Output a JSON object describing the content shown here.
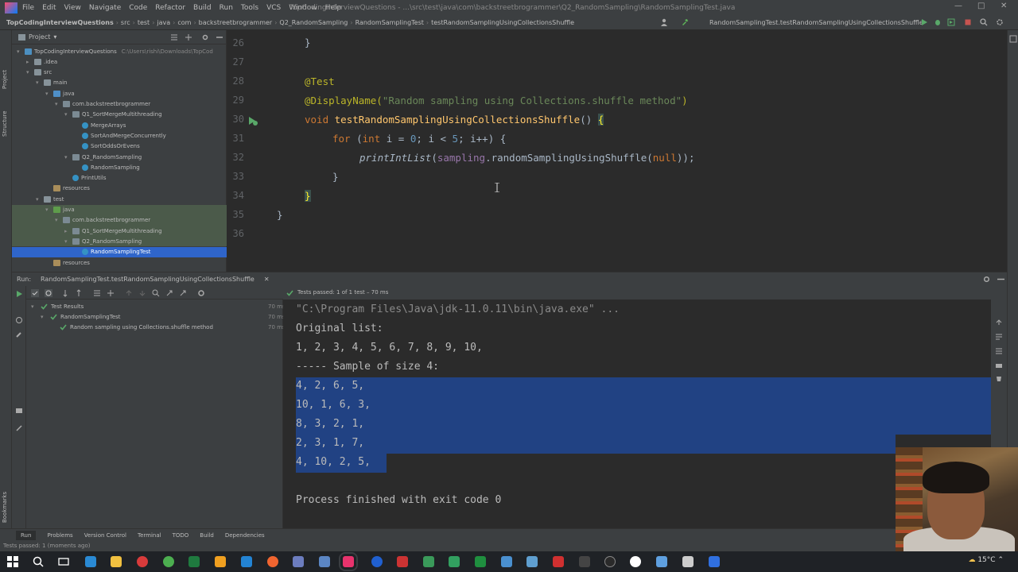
{
  "menubar": {
    "items": [
      "File",
      "Edit",
      "View",
      "Navigate",
      "Code",
      "Refactor",
      "Build",
      "Run",
      "Tools",
      "VCS",
      "Window",
      "Help"
    ],
    "title": "TopCodingInterviewQuestions - ...\\src\\test\\java\\com\\backstreetbrogrammer\\Q2_RandomSampling\\RandomSamplingTest.java"
  },
  "navbar": {
    "crumbs": [
      "TopCodingInterviewQuestions",
      "src",
      "test",
      "java",
      "com",
      "backstreetbrogrammer",
      "Q2_RandomSampling",
      "RandomSamplingTest",
      "testRandomSamplingUsingCollectionsShuffle"
    ],
    "run_config": "RandomSamplingTest.testRandomSamplingUsingCollectionsShuffle"
  },
  "left_stripe": {
    "project_label": "Project",
    "structure_label": "Structure",
    "bookmarks_label": "Bookmarks"
  },
  "project_panel": {
    "header": "Project",
    "tree": [
      {
        "label": "TopCodingInterviewQuestions",
        "extra": "C:\\Users\\rishi\\Downloads\\TopCod",
        "indent": 0,
        "arrow": "▾",
        "icon": "mod"
      },
      {
        "label": ".idea",
        "indent": 1,
        "arrow": "▸",
        "icon": "folder"
      },
      {
        "label": "src",
        "indent": 1,
        "arrow": "▾",
        "icon": "folder"
      },
      {
        "label": "main",
        "indent": 2,
        "arrow": "▾",
        "icon": "folder"
      },
      {
        "label": "java",
        "indent": 3,
        "arrow": "▾",
        "icon": "src"
      },
      {
        "label": "com.backstreetbrogrammer",
        "indent": 4,
        "arrow": "▾",
        "icon": "pkg"
      },
      {
        "label": "Q1_SortMergeMultithreading",
        "indent": 5,
        "arrow": "▾",
        "icon": "pkg"
      },
      {
        "label": "MergeArrays",
        "indent": 6,
        "arrow": "",
        "icon": "cls"
      },
      {
        "label": "SortAndMergeConcurrently",
        "indent": 6,
        "arrow": "",
        "icon": "cls"
      },
      {
        "label": "SortOddsOrEvens",
        "indent": 6,
        "arrow": "",
        "icon": "cls"
      },
      {
        "label": "Q2_RandomSampling",
        "indent": 5,
        "arrow": "▾",
        "icon": "pkg"
      },
      {
        "label": "RandomSampling",
        "indent": 6,
        "arrow": "",
        "icon": "cls"
      },
      {
        "label": "PrintUtils",
        "indent": 5,
        "arrow": "",
        "icon": "cls"
      },
      {
        "label": "resources",
        "indent": 3,
        "arrow": "",
        "icon": "res"
      },
      {
        "label": "test",
        "indent": 2,
        "arrow": "▾",
        "icon": "folder"
      },
      {
        "label": "java",
        "indent": 3,
        "arrow": "▾",
        "icon": "test"
      },
      {
        "label": "com.backstreetbrogrammer",
        "indent": 4,
        "arrow": "▾",
        "icon": "pkg"
      },
      {
        "label": "Q1_SortMergeMultithreading",
        "indent": 5,
        "arrow": "▸",
        "icon": "pkg"
      },
      {
        "label": "Q2_RandomSampling",
        "indent": 5,
        "arrow": "▾",
        "icon": "pkg"
      },
      {
        "label": "RandomSamplingTest",
        "indent": 6,
        "arrow": "",
        "icon": "cls"
      },
      {
        "label": "resources",
        "indent": 3,
        "arrow": "",
        "icon": "res"
      }
    ]
  },
  "editor": {
    "line_numbers": [
      "26",
      "27",
      "28",
      "29",
      "30",
      "31",
      "32",
      "33",
      "34",
      "35",
      "36"
    ],
    "code": {
      "l26": "}",
      "l28": "@Test",
      "l29_ann": "@DisplayName(",
      "l29_str": "\"Random sampling using Collections.shuffle method\"",
      "l29_end": ")",
      "l30_kw": "void ",
      "l30_fn": "testRandomSamplingUsingCollectionsShuffle",
      "l30_rest": "() ",
      "l30_brace": "{",
      "l31_kw1": "for ",
      "l31_a": "(",
      "l31_kw2": "int ",
      "l31_b": "i = ",
      "l31_n0": "0",
      "l31_c": "; i < ",
      "l31_n5": "5",
      "l31_d": "; i++) {",
      "l32_fn": "printIntList",
      "l32_a": "(",
      "l32_fld": "sampling",
      "l32_b": ".randomSamplingUsingShuffle(",
      "l32_null": "null",
      "l32_c": "));",
      "l33": "}",
      "l34": "}",
      "l35": "}"
    }
  },
  "run_panel": {
    "run_label": "Run:",
    "tab_label": "RandomSamplingTest.testRandomSamplingUsingCollectionsShuffle",
    "tests_passed": "Tests passed: 1 of 1 test – 70 ms",
    "tree": [
      {
        "label": "Test Results",
        "time": "70 ms"
      },
      {
        "label": "RandomSamplingTest",
        "time": "70 ms"
      },
      {
        "label": "Random sampling using Collections.shuffle method",
        "time": "70 ms"
      }
    ],
    "console": [
      "\"C:\\Program Files\\Java\\jdk-11.0.11\\bin\\java.exe\" ...",
      "Original list:",
      "1, 2, 3, 4, 5, 6, 7, 8, 9, 10,",
      "----- Sample of size 4:",
      "4, 2, 6, 5,",
      "10, 1, 6, 3,",
      "8, 3, 2, 1,",
      "2, 3, 1, 7,",
      "4, 10, 2, 5,",
      "",
      "Process finished with exit code 0"
    ]
  },
  "bottom_tabs": [
    "Run",
    "Problems",
    "Version Control",
    "Terminal",
    "TODO",
    "Build",
    "Dependencies"
  ],
  "status_bar": "Tests passed: 1 (moments ago)",
  "taskbar": {
    "temperature": "15°C"
  },
  "colors": {
    "background": "#2b2b2b",
    "panel": "#3c3f41",
    "selection": "#214283",
    "tree_selection": "#2f65ca",
    "annotation": "#bbb529",
    "string": "#6a8759",
    "keyword": "#cc7832",
    "function": "#ffc66d",
    "number": "#6897bb",
    "field": "#9876aa"
  }
}
